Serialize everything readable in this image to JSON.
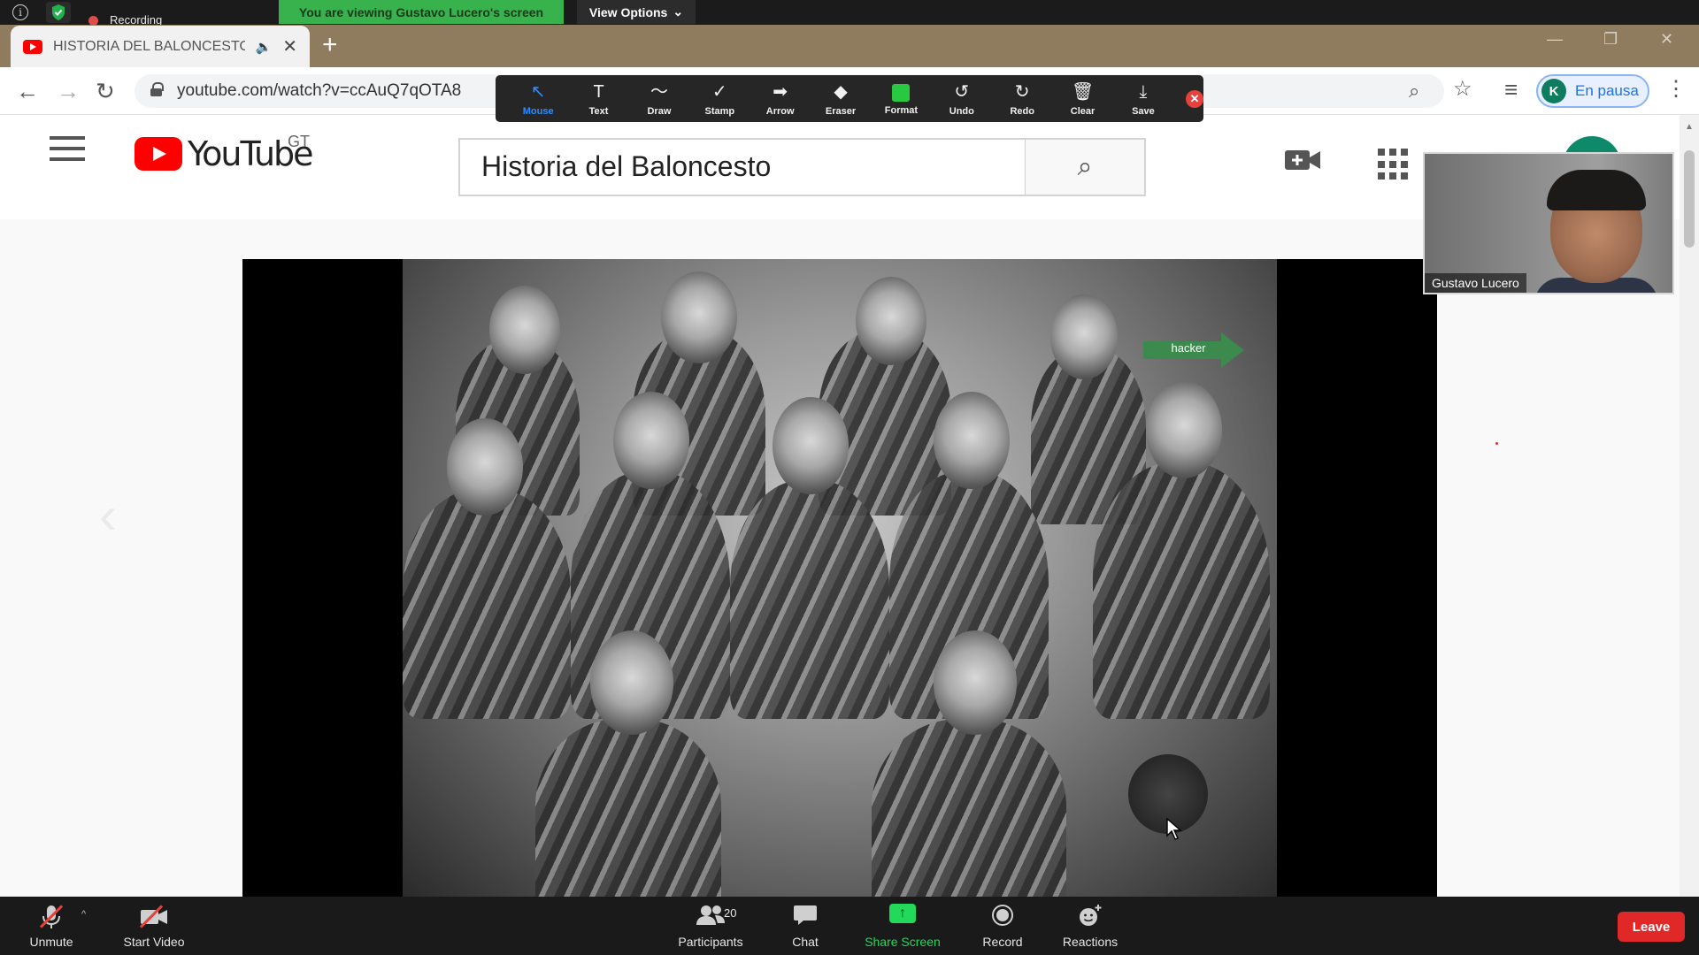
{
  "zoom_top": {
    "recording_label": "Recording",
    "viewing_banner": "You are viewing Gustavo Lucero's screen",
    "view_options_label": "View Options",
    "view_options_caret": "⌄"
  },
  "browser": {
    "tab_title": "HISTORIA DEL BALONCESTO",
    "tab_audio_icon": "🔈",
    "tab_close": "✕",
    "new_tab": "+",
    "window_minimize": "—",
    "window_restore": "❐",
    "window_close": "✕",
    "back": "←",
    "forward": "→",
    "reload": "↻",
    "url": "youtube.com/watch?v=ccAuQ7qOTA8",
    "zoom_icon": "⌕",
    "star_icon": "☆",
    "queue_icon": "≡",
    "menu_icon": "⋮",
    "profile_initial": "K",
    "profile_label": "En pausa"
  },
  "youtube": {
    "logo_word": "YouTube",
    "region": "GT",
    "search_query": "Historia del Baloncesto",
    "search_icon": "⌕",
    "create_icon": "📹"
  },
  "annotate": {
    "tools": [
      {
        "label": "Mouse",
        "glyph": "↖",
        "active": true
      },
      {
        "label": "Text",
        "glyph": "T",
        "active": false
      },
      {
        "label": "Draw",
        "glyph": "〜",
        "active": false
      },
      {
        "label": "Stamp",
        "glyph": "✓",
        "active": false
      },
      {
        "label": "Arrow",
        "glyph": "➡",
        "active": false
      },
      {
        "label": "Eraser",
        "glyph": "◆",
        "active": false
      },
      {
        "label": "Format",
        "glyph": "",
        "active": false
      },
      {
        "label": "Undo",
        "glyph": "↺",
        "active": false
      },
      {
        "label": "Redo",
        "glyph": "↻",
        "active": false
      },
      {
        "label": "Clear",
        "glyph": "🗑",
        "active": false
      },
      {
        "label": "Save",
        "glyph": "⤓",
        "active": false
      }
    ],
    "close_glyph": "✕",
    "format_color": "#28c840"
  },
  "video": {
    "annotation_label": "hacker",
    "annotation_color": "#3c8a4e",
    "prev_chevron": "‹"
  },
  "participant_tile": {
    "name": "Gustavo Lucero"
  },
  "zoom_bottom": {
    "unmute_label": "Unmute",
    "start_video_label": "Start Video",
    "participants_label": "Participants",
    "participants_count": "20",
    "chat_label": "Chat",
    "share_label": "Share Screen",
    "record_label": "Record",
    "reactions_label": "Reactions",
    "leave_label": "Leave",
    "caret": "^"
  },
  "colors": {
    "share_green": "#23d959",
    "leave_red": "#e02828",
    "banner_green": "#37b24d",
    "annotate_active": "#2d8cff"
  }
}
